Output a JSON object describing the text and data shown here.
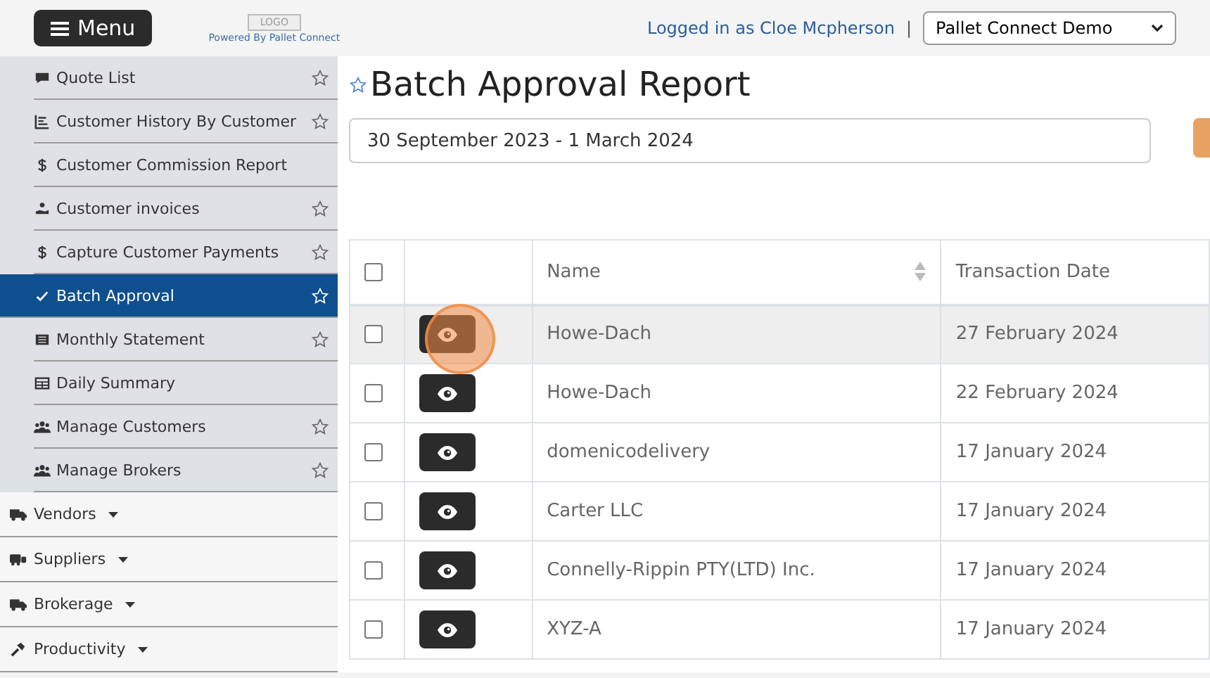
{
  "header": {
    "menu_button": "Menu",
    "logo": "LOGO",
    "powered_by": "Powered By Pallet Connect",
    "logged_in": "Logged in as Cloe Mcpherson",
    "separator": "|",
    "company_select": "Pallet Connect Demo"
  },
  "sidebar": {
    "items": [
      {
        "label": "Quote List",
        "kind": "quote",
        "starred": true,
        "selected": false
      },
      {
        "label": "Customer History By Customer",
        "kind": "history",
        "starred": true,
        "selected": false
      },
      {
        "label": "Customer Commission Report",
        "kind": "dollar",
        "starred": false,
        "selected": false
      },
      {
        "label": "Customer invoices",
        "kind": "invoice",
        "starred": true,
        "selected": false
      },
      {
        "label": "Capture Customer Payments",
        "kind": "dollar",
        "starred": true,
        "selected": false
      },
      {
        "label": "Batch Approval",
        "kind": "check",
        "starred": true,
        "selected": true
      },
      {
        "label": "Monthly Statement",
        "kind": "statement",
        "starred": true,
        "selected": false
      },
      {
        "label": "Daily Summary",
        "kind": "table",
        "starred": false,
        "selected": false
      },
      {
        "label": "Manage Customers",
        "kind": "users",
        "starred": true,
        "selected": false
      },
      {
        "label": "Manage Brokers",
        "kind": "users",
        "starred": true,
        "selected": false
      }
    ],
    "sections": [
      {
        "label": "Vendors",
        "kind": "truck"
      },
      {
        "label": "Suppliers",
        "kind": "bus"
      },
      {
        "label": "Brokerage",
        "kind": "truck"
      },
      {
        "label": "Productivity",
        "kind": "hammer"
      }
    ]
  },
  "main": {
    "title": "Batch Approval Report",
    "date_range": "30 September 2023 - 1 March 2024",
    "table": {
      "select_all_checked": false,
      "columns": [
        "Name",
        "Transaction Date"
      ],
      "rows": [
        {
          "name": "Howe-Dach",
          "date": "27 February 2024",
          "checked": false,
          "hovered": true
        },
        {
          "name": "Howe-Dach",
          "date": "22 February 2024",
          "checked": false,
          "hovered": false
        },
        {
          "name": "domenicodelivery",
          "date": "17 January 2024",
          "checked": false,
          "hovered": false
        },
        {
          "name": "Carter LLC",
          "date": "17 January 2024",
          "checked": false,
          "hovered": false
        },
        {
          "name": "Connelly-Rippin PTY(LTD) Inc.",
          "date": "17 January 2024",
          "checked": false,
          "hovered": false
        },
        {
          "name": "XYZ-A",
          "date": "17 January 2024",
          "checked": false,
          "hovered": false
        }
      ]
    }
  }
}
